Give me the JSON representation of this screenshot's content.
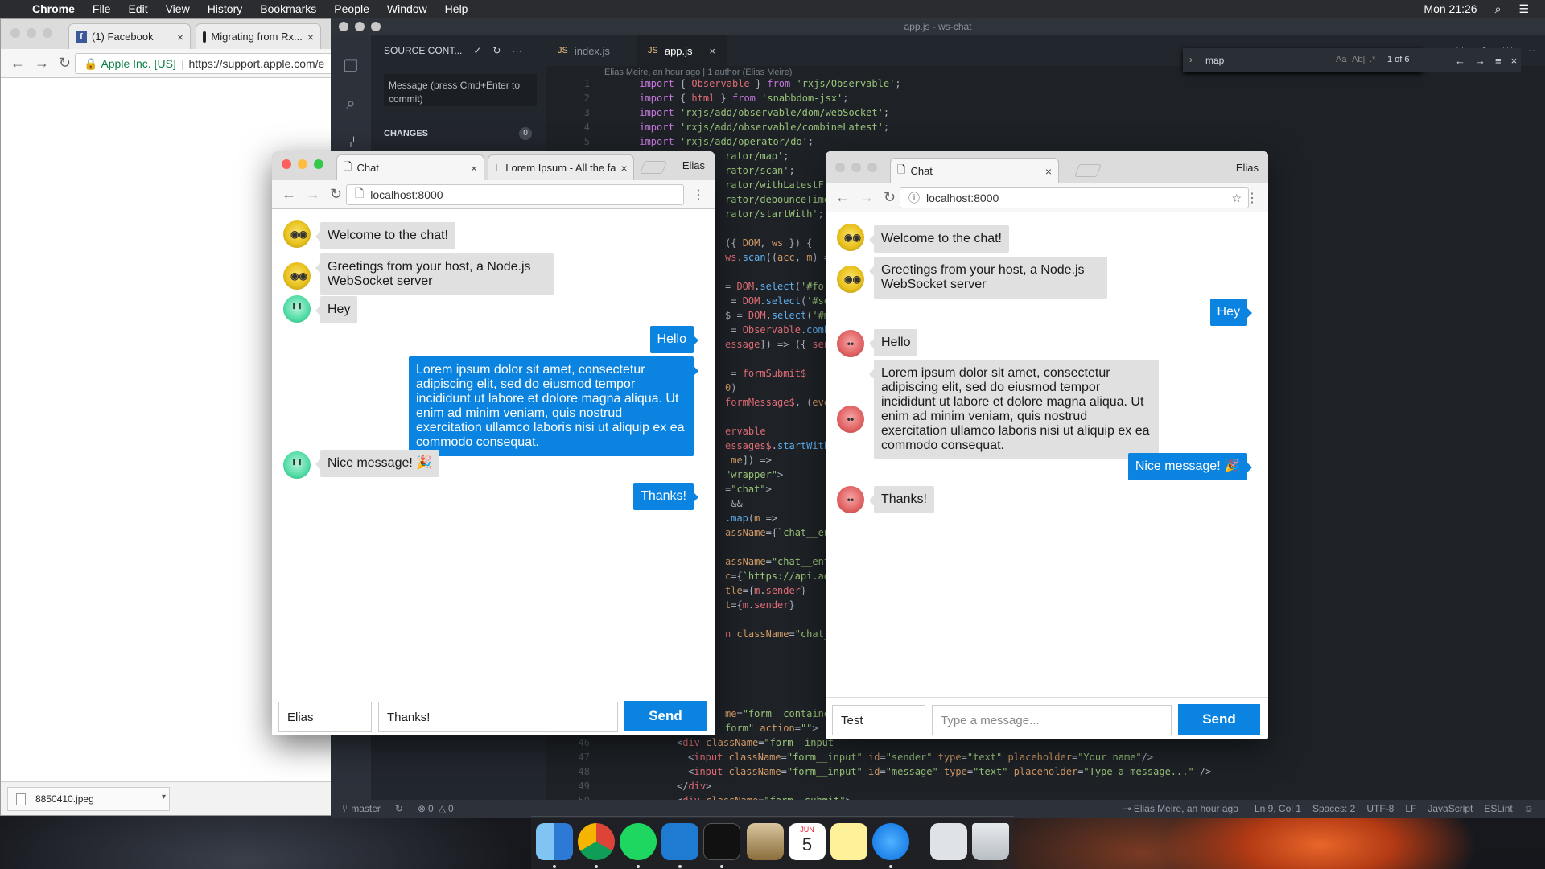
{
  "menubar": {
    "app": "Chrome",
    "items": [
      "File",
      "Edit",
      "View",
      "History",
      "Bookmarks",
      "People",
      "Window",
      "Help"
    ],
    "clock": "Mon 21:26"
  },
  "back_browser": {
    "tabs": [
      {
        "label": "(1) Facebook"
      },
      {
        "label": "Migrating from Rx..."
      }
    ],
    "secure_label": "Apple Inc. [US]",
    "url": "https://support.apple.com/e",
    "download": "8850410.jpeg"
  },
  "vscode": {
    "title": "app.js - ws-chat",
    "sidebar_title": "SOURCE CONT...",
    "commit_placeholder": "Message (press Cmd+Enter to commit)",
    "changes_label": "CHANGES",
    "changes_count": "0",
    "tabs": [
      {
        "label": "index.js"
      },
      {
        "label": "app.js"
      }
    ],
    "blame": "Elias Meire, an hour ago | 1 author (Elias Meire)",
    "find": {
      "query": "map",
      "count": "1 of 6",
      "opt1": "Aa",
      "opt2": "Ab|",
      "opt3": ".*"
    },
    "gutter": [
      "1",
      "2",
      "3",
      "4",
      "5",
      "46",
      "47",
      "48",
      "49",
      "50"
    ],
    "status": {
      "branch": "master",
      "errors": "0",
      "warnings": "0",
      "blame": "Elias Meire, an hour ago",
      "position": "Ln 9, Col 1",
      "spaces": "Spaces: 2",
      "encoding": "UTF-8",
      "eol": "LF",
      "language": "JavaScript",
      "linter": "ESLint"
    }
  },
  "chat_left": {
    "tabs": [
      {
        "label": "Chat"
      },
      {
        "label": "Lorem Ipsum - All the fa"
      }
    ],
    "profile": "Elias",
    "url": "localhost:8000",
    "messages": [
      {
        "text": "Welcome to the chat!"
      },
      {
        "text": "Greetings from your host, a Node.js WebSocket server"
      },
      {
        "text": "Hey"
      },
      {
        "text": "Hello"
      },
      {
        "text": "Lorem ipsum dolor sit amet, consectetur adipiscing elit, sed do eiusmod tempor incididunt ut labore et dolore magna aliqua. Ut enim ad minim veniam, quis nostrud exercitation ullamco laboris nisi ut aliquip ex ea commodo consequat."
      },
      {
        "text": "Nice message! 🎉"
      },
      {
        "text": "Thanks!"
      }
    ],
    "name_value": "Elias",
    "message_value": "Thanks!",
    "send": "Send"
  },
  "chat_right": {
    "tabs": [
      {
        "label": "Chat"
      }
    ],
    "profile": "Elias",
    "url": "localhost:8000",
    "messages": [
      {
        "text": "Welcome to the chat!"
      },
      {
        "text": "Greetings from your host, a Node.js WebSocket server"
      },
      {
        "text": "Hey"
      },
      {
        "text": "Hello"
      },
      {
        "text": "Lorem ipsum dolor sit amet, consectetur adipiscing elit, sed do eiusmod tempor incididunt ut labore et dolore magna aliqua. Ut enim ad minim veniam, quis nostrud exercitation ullamco laboris nisi ut aliquip ex ea commodo consequat."
      },
      {
        "text": "Nice message! 🎉"
      },
      {
        "text": "Thanks!"
      }
    ],
    "name_value": "Test",
    "message_placeholder": "Type a message...",
    "send": "Send"
  },
  "dock": {
    "calendar_month": "JUN",
    "calendar_day": "5"
  }
}
